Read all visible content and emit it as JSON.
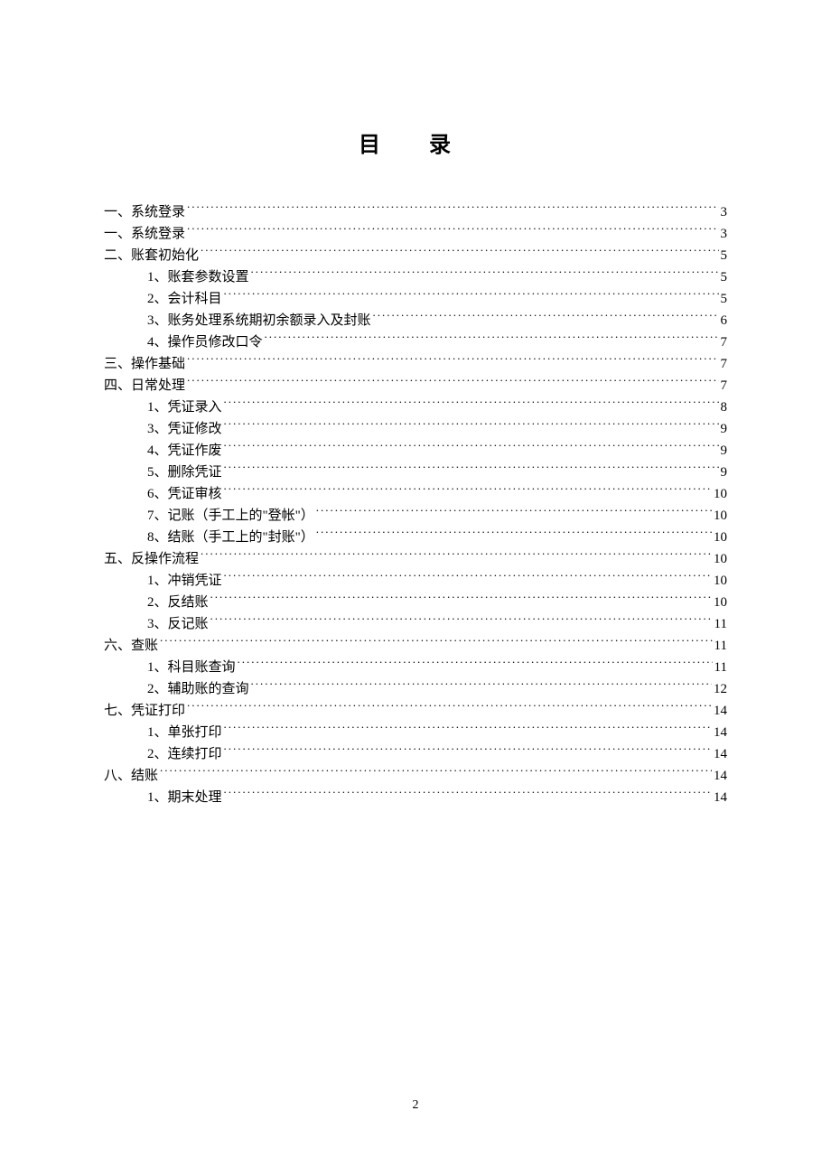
{
  "title": "目 录",
  "page_number": "2",
  "toc": [
    {
      "level": 1,
      "label": "一、系统登录",
      "page": "3"
    },
    {
      "level": 1,
      "label": "一、系统登录",
      "page": "3"
    },
    {
      "level": 1,
      "label": "二、账套初始化",
      "page": "5"
    },
    {
      "level": 2,
      "label": "1、账套参数设置",
      "page": "5"
    },
    {
      "level": 2,
      "label": "2、会计科目",
      "page": "5"
    },
    {
      "level": 2,
      "label": "3、账务处理系统期初余额录入及封账",
      "page": "6"
    },
    {
      "level": 2,
      "label": "4、操作员修改口令",
      "page": "7"
    },
    {
      "level": 1,
      "label": "三、操作基础",
      "page": "7"
    },
    {
      "level": 1,
      "label": "四、日常处理",
      "page": "7"
    },
    {
      "level": 2,
      "label": "1、凭证录入",
      "page": "8"
    },
    {
      "level": 2,
      "label": "3、凭证修改",
      "page": "9"
    },
    {
      "level": 2,
      "label": "4、凭证作废",
      "page": "9"
    },
    {
      "level": 2,
      "label": "5、删除凭证",
      "page": "9"
    },
    {
      "level": 2,
      "label": "6、凭证审核",
      "page": "10"
    },
    {
      "level": 2,
      "label": "7、记账（手工上的\"登帐\"）",
      "page": "10"
    },
    {
      "level": 2,
      "label": "8、结账（手工上的\"封账\"）",
      "page": "10"
    },
    {
      "level": 1,
      "label": "五、反操作流程",
      "page": "10"
    },
    {
      "level": 2,
      "label": "1、冲销凭证",
      "page": "10"
    },
    {
      "level": 2,
      "label": "2、反结账",
      "page": "10"
    },
    {
      "level": 2,
      "label": "3、反记账",
      "page": "11"
    },
    {
      "level": 1,
      "label": "六、查账",
      "page": "11"
    },
    {
      "level": 2,
      "label": "1、科目账查询",
      "page": "11"
    },
    {
      "level": 2,
      "label": "2、辅助账的查询",
      "page": "12"
    },
    {
      "level": 1,
      "label": "七、凭证打印",
      "page": "14"
    },
    {
      "level": 2,
      "label": "1、单张打印",
      "page": "14"
    },
    {
      "level": 2,
      "label": "2、连续打印",
      "page": "14"
    },
    {
      "level": 1,
      "label": "八、结账",
      "page": "14"
    },
    {
      "level": 2,
      "label": "1、期末处理",
      "page": "14"
    }
  ]
}
